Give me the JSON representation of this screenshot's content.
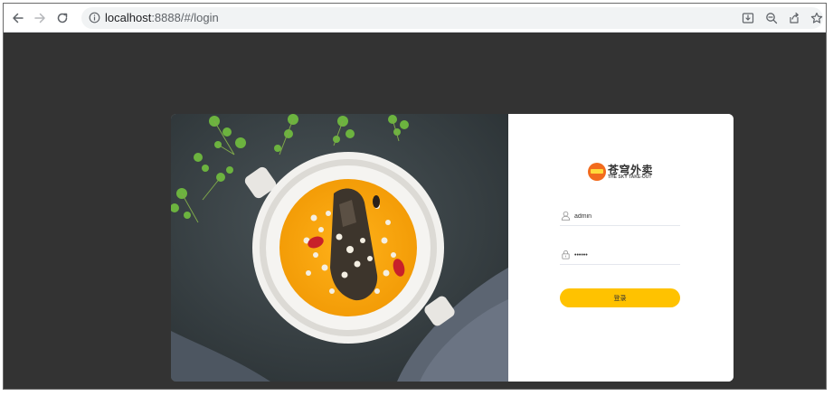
{
  "browser": {
    "url_host": "localhost",
    "url_rest": ":8888/#/login"
  },
  "icons": {
    "back": "arrow-left-icon",
    "forward": "arrow-right-icon",
    "reload": "reload-icon",
    "site_info": "info-icon",
    "install": "install-app-icon",
    "zoom": "zoom-out-icon",
    "share": "share-icon",
    "bookmark": "star-icon",
    "user": "user-icon",
    "lock": "lock-icon"
  },
  "brand": {
    "name": "苍穹外卖",
    "subtitle": "THE SKY TAKE-OUT"
  },
  "form": {
    "username_value": "admin",
    "password_value": "123456",
    "submit_label": "登录"
  },
  "colors": {
    "accent": "#ffc200",
    "page_background": "#333333",
    "logo_orange": "#f26b1d"
  }
}
